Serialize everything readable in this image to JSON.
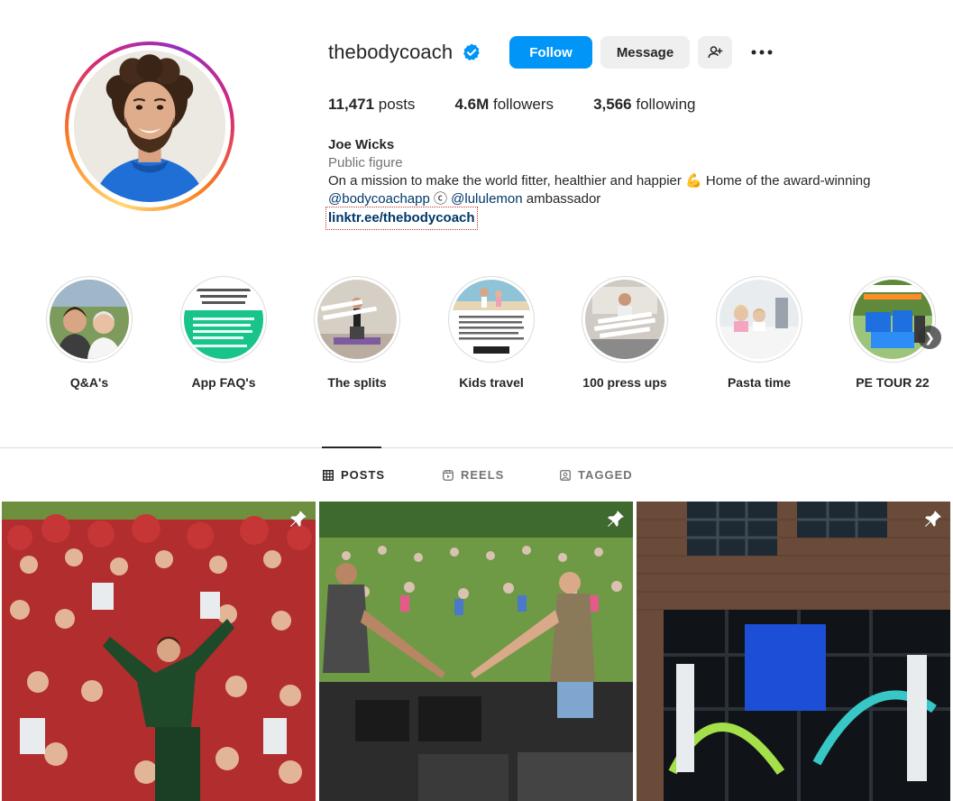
{
  "profile": {
    "username": "thebodycoach",
    "follow_label": "Follow",
    "message_label": "Message",
    "stats": {
      "posts_count": "11,471",
      "posts_label": "posts",
      "followers_count": "4.6M",
      "followers_label": "followers",
      "following_count": "3,566",
      "following_label": "following"
    },
    "name": "Joe Wicks",
    "category": "Public figure",
    "bio_line1": "On a mission to make the world fitter, healthier and happier 💪 Home of the award-winning",
    "bio_mention1": "@bodycoachapp",
    "bio_mid": " ⓒ ",
    "bio_mention2": "@lululemon",
    "bio_tail": " ambassador",
    "link": "linktr.ee/thebodycoach"
  },
  "highlights": [
    {
      "label": "Q&A's",
      "icon": "photo"
    },
    {
      "label": "App FAQ's",
      "icon": "text"
    },
    {
      "label": "The splits",
      "icon": "photo"
    },
    {
      "label": "Kids travel",
      "icon": "text"
    },
    {
      "label": "100 press ups",
      "icon": "photo"
    },
    {
      "label": "Pasta time",
      "icon": "photo"
    },
    {
      "label": "PE TOUR 22",
      "icon": "photo"
    }
  ],
  "tabs": [
    {
      "label": "POSTS",
      "icon": "grid-icon",
      "active": true
    },
    {
      "label": "REELS",
      "icon": "reels-icon",
      "active": false
    },
    {
      "label": "TAGGED",
      "icon": "tagged-icon",
      "active": false
    }
  ],
  "posts": [
    {
      "pinned": true,
      "icon": "pin-icon"
    },
    {
      "pinned": true,
      "icon": "pin-icon"
    },
    {
      "pinned": true,
      "icon": "pin-icon"
    }
  ],
  "colors": {
    "follow_button": "#0095f6",
    "secondary_button": "#efefef",
    "link": "#00376b",
    "verified": "#0095f6"
  }
}
